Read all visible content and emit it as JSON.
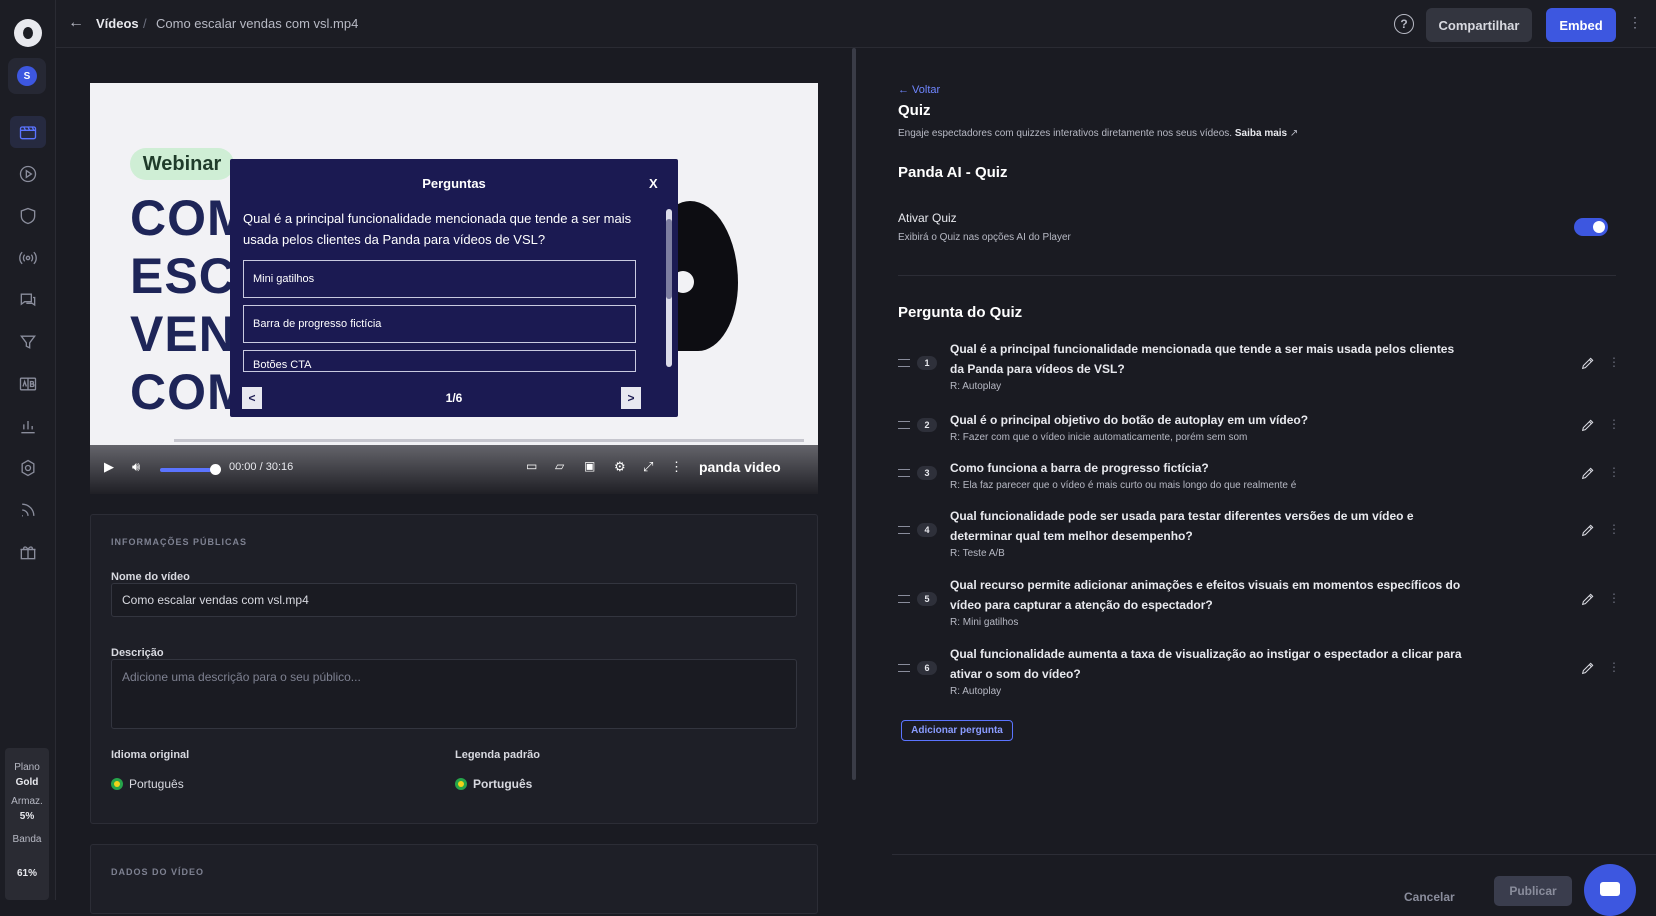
{
  "sidebar": {
    "avatar_initial": "S",
    "nav": [
      "videos-icon",
      "play-icon",
      "shield-icon",
      "live-icon",
      "chat-icon",
      "funnel-icon",
      "ab-test-icon",
      "analytics-icon",
      "settings-icon",
      "rss-icon",
      "gift-icon"
    ],
    "plan": {
      "label": "Plano",
      "name": "Gold",
      "storage_label": "Armaz.",
      "storage_value": "5%",
      "band_label": "Banda",
      "band_value": "61%"
    }
  },
  "topbar": {
    "breadcrumb_root": "Vídeos",
    "breadcrumb_sep": "/",
    "breadcrumb_current": "Como escalar vendas com vsl.mp4",
    "share_label": "Compartilhar",
    "embed_label": "Embed",
    "help_glyph": "?",
    "more_glyph": "⋮"
  },
  "video": {
    "tag": "Webinar",
    "lines": [
      "COM",
      "ESC",
      "VEN",
      "COM VSL"
    ],
    "time_current": "00:00",
    "time_sep": "/",
    "time_total": "30:16",
    "brand": "panda video",
    "progress": 0.1,
    "volume": 0.85
  },
  "quiz_modal": {
    "title": "Perguntas",
    "close": "X",
    "question": "Qual é a principal funcionalidade mencionada que tende a ser mais usada pelos clientes da Panda para vídeos de VSL?",
    "options": [
      "Mini gatilhos",
      "Barra de progresso fictícia",
      "Botões CTA"
    ],
    "prev": "<",
    "next": ">",
    "pager": "1/6"
  },
  "info": {
    "section": "INFORMAÇÕES PÚBLICAS",
    "name_label": "Nome do vídeo",
    "name_value": "Como escalar vendas com vsl.mp4",
    "desc_label": "Descrição",
    "desc_placeholder": "Adicione uma descrição para o seu público...",
    "orig_lang_label": "Idioma original",
    "orig_lang_value": "Português",
    "subtitle_label": "Legenda padrão",
    "subtitle_value": "Português",
    "data_section": "DADOS DO VÍDEO"
  },
  "quiz_panel": {
    "back": "← Voltar",
    "title": "Quiz",
    "desc": "Engaje espectadores com quizzes interativos diretamente nos seus vídeos.",
    "learn_more": "Saiba mais",
    "ai_title": "Panda AI - Quiz",
    "toggle_label": "Ativar Quiz",
    "toggle_sub": "Exibirá o Quiz nas opções AI do Player",
    "toggle_on": true,
    "questions_title": "Pergunta do Quiz",
    "questions": [
      {
        "num": "1",
        "text": "Qual é a principal funcionalidade mencionada que tende a ser mais usada pelos clientes da Panda para vídeos de VSL?",
        "answer": "R: Autoplay"
      },
      {
        "num": "2",
        "text": "Qual é o principal objetivo do botão de autoplay em um vídeo?",
        "answer": "R: Fazer com que o vídeo inicie automaticamente, porém sem som"
      },
      {
        "num": "3",
        "text": "Como funciona a barra de progresso fictícia?",
        "answer": "R: Ela faz parecer que o vídeo é mais curto ou mais longo do que realmente é"
      },
      {
        "num": "4",
        "text": "Qual funcionalidade pode ser usada para testar diferentes versões de um vídeo e determinar qual tem melhor desempenho?",
        "answer": "R: Teste A/B"
      },
      {
        "num": "5",
        "text": "Qual recurso permite adicionar animações e efeitos visuais em momentos específicos do vídeo para capturar a atenção do espectador?",
        "answer": "R: Mini gatilhos"
      },
      {
        "num": "6",
        "text": "Qual funcionalidade aumenta a taxa de visualização ao instigar o espectador a clicar para ativar o som do vídeo?",
        "answer": "R: Autoplay"
      }
    ],
    "add_label": "Adicionar pergunta",
    "cancel_label": "Cancelar",
    "publish_label": "Publicar",
    "row_more_glyph": "⋮"
  }
}
